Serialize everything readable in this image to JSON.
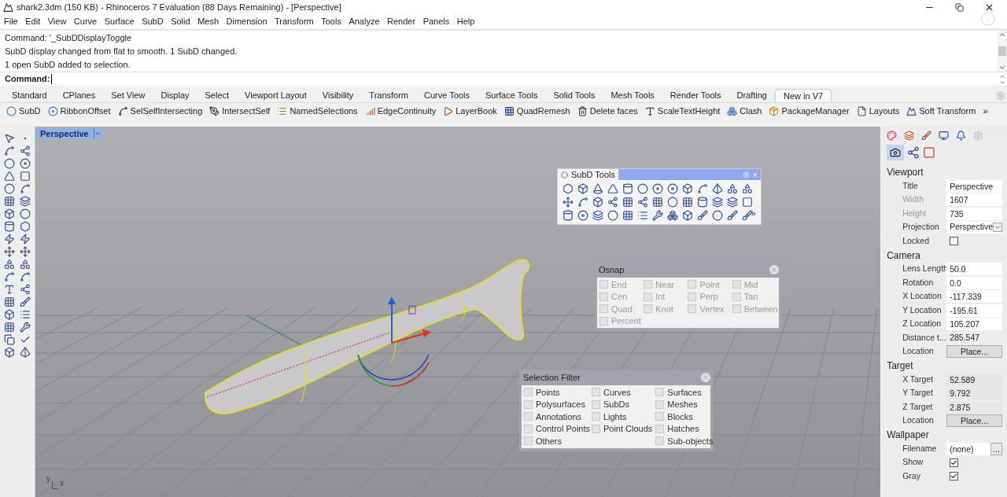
{
  "window": {
    "title": "shark2.3dm (150 KB) - Rhinoceros 7 Evaluation (88 Days Remaining) - [Perspective]"
  },
  "menu": [
    "File",
    "Edit",
    "View",
    "Curve",
    "Surface",
    "SubD",
    "Solid",
    "Mesh",
    "Dimension",
    "Transform",
    "Tools",
    "Analyze",
    "Render",
    "Panels",
    "Help"
  ],
  "command_history": [
    "Command: '_SubDDisplayToggle",
    "SubD display changed from flat to smooth. 1 SubD changed.",
    "1 open SubD added to selection."
  ],
  "command_prompt": {
    "label": "Command:"
  },
  "toolbar_tabs": [
    {
      "label": "Standard",
      "selected": false
    },
    {
      "label": "CPlanes",
      "selected": false
    },
    {
      "label": "Set View",
      "selected": false
    },
    {
      "label": "Display",
      "selected": false
    },
    {
      "label": "Select",
      "selected": false
    },
    {
      "label": "Viewport Layout",
      "selected": false
    },
    {
      "label": "Visibility",
      "selected": false
    },
    {
      "label": "Transform",
      "selected": false
    },
    {
      "label": "Curve Tools",
      "selected": false
    },
    {
      "label": "Surface Tools",
      "selected": false
    },
    {
      "label": "Solid Tools",
      "selected": false
    },
    {
      "label": "Mesh Tools",
      "selected": false
    },
    {
      "label": "Render Tools",
      "selected": false
    },
    {
      "label": "Drafting",
      "selected": false
    },
    {
      "label": "New in V7",
      "selected": true
    }
  ],
  "ribbon": {
    "items": [
      "SubD",
      "RibbonOffset",
      "SelSelfIntersecting",
      "IntersectSelf",
      "NamedSelections",
      "EdgeContinuity",
      "LayerBook",
      "QuadRemesh",
      "Delete faces",
      "ScaleTextHeight",
      "Clash",
      "PackageManager",
      "Layouts",
      "Soft Transform"
    ],
    "overflow": "»"
  },
  "viewport": {
    "tab": {
      "label": "Perspective",
      "selected": true
    },
    "axis_labels": [
      "y",
      "x"
    ]
  },
  "subd_tools": {
    "title": "SubD Tools",
    "close": "×",
    "overflow": "»"
  },
  "osnap": {
    "title": "Osnap",
    "items": [
      {
        "label": "End",
        "checked": false
      },
      {
        "label": "Near",
        "checked": false
      },
      {
        "label": "Point",
        "checked": false
      },
      {
        "label": "Mid",
        "checked": false
      },
      {
        "label": "Cen",
        "checked": false
      },
      {
        "label": "Int",
        "checked": false
      },
      {
        "label": "Perp",
        "checked": false
      },
      {
        "label": "Tan",
        "checked": false
      },
      {
        "label": "Quad",
        "checked": false
      },
      {
        "label": "Knot",
        "checked": false
      },
      {
        "label": "Vertex",
        "checked": false
      },
      {
        "label": "Between",
        "checked": false
      },
      {
        "label": "Percent",
        "checked": false
      }
    ]
  },
  "selection_filter": {
    "title": "Selection Filter",
    "columns": [
      [
        {
          "label": "Points",
          "checked": false
        },
        {
          "label": "Polysurfaces",
          "checked": false
        },
        {
          "label": "Annotations",
          "checked": false
        },
        {
          "label": "Control Points",
          "checked": false
        },
        {
          "label": "Others",
          "checked": false
        }
      ],
      [
        {
          "label": "Curves",
          "checked": false
        },
        {
          "label": "SubDs",
          "checked": false
        },
        {
          "label": "Lights",
          "checked": false
        },
        {
          "label": "Point Clouds",
          "checked": false
        }
      ],
      [
        {
          "label": "Surfaces",
          "checked": false
        },
        {
          "label": "Meshes",
          "checked": false
        },
        {
          "label": "Blocks",
          "checked": false
        },
        {
          "label": "Hatches",
          "checked": false
        },
        {
          "label": "Sub-objects",
          "checked": false
        }
      ]
    ]
  },
  "properties": {
    "sections": [
      {
        "title": "Viewport",
        "rows": [
          {
            "label": "Title",
            "kind": "field",
            "value": "Perspective"
          },
          {
            "label": "Width",
            "kind": "field",
            "value": "1607",
            "greyed": true
          },
          {
            "label": "Height",
            "kind": "field",
            "value": "735",
            "greyed": true
          },
          {
            "label": "Projection",
            "kind": "dropdown",
            "value": "Perspective"
          },
          {
            "label": "Locked",
            "kind": "checkbox",
            "checked": false
          }
        ]
      },
      {
        "title": "Camera",
        "rows": [
          {
            "label": "Lens Length",
            "kind": "field",
            "value": "50.0"
          },
          {
            "label": "Rotation",
            "kind": "field",
            "value": "0.0"
          },
          {
            "label": "X Location",
            "kind": "field",
            "value": "-117.339"
          },
          {
            "label": "Y Location",
            "kind": "field",
            "value": "-195.61"
          },
          {
            "label": "Z Location",
            "kind": "field",
            "value": "105.207"
          },
          {
            "label": "Distance t...",
            "kind": "static",
            "value": "285.547"
          },
          {
            "label": "Location",
            "kind": "button",
            "value": "Place..."
          }
        ]
      },
      {
        "title": "Target",
        "rows": [
          {
            "label": "X Target",
            "kind": "readonly",
            "value": "52.589"
          },
          {
            "label": "Y Target",
            "kind": "readonly",
            "value": "9.792"
          },
          {
            "label": "Z Target",
            "kind": "readonly",
            "value": "2.875"
          },
          {
            "label": "Location",
            "kind": "button",
            "value": "Place..."
          }
        ]
      },
      {
        "title": "Wallpaper",
        "rows": [
          {
            "label": "Filename",
            "kind": "file",
            "value": "(none)",
            "button": "..."
          },
          {
            "label": "Show",
            "kind": "checkbox",
            "checked": true
          },
          {
            "label": "Gray",
            "kind": "checkbox",
            "checked": true
          }
        ]
      }
    ]
  }
}
